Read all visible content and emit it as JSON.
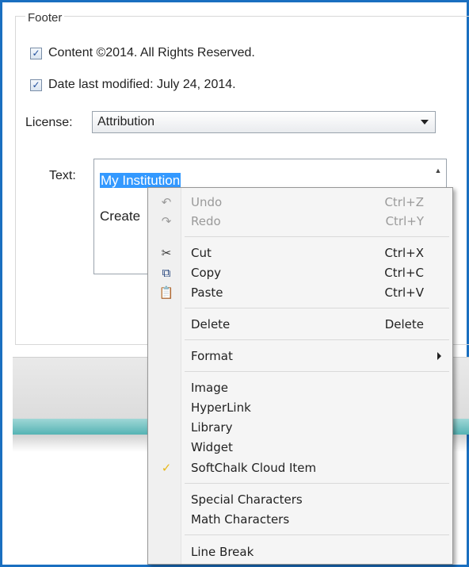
{
  "footer": {
    "legend": "Footer",
    "content_checkbox": {
      "checked": true,
      "label": "Content ©2014. All Rights Reserved."
    },
    "date_checkbox": {
      "checked": true,
      "label": "Date last modified: July 24, 2014."
    },
    "license": {
      "label": "License:",
      "value": "Attribution"
    },
    "text": {
      "label": "Text:",
      "line1_selected": "My Institution",
      "line2": "Create"
    }
  },
  "context_menu": {
    "undo": {
      "label": "Undo",
      "shortcut": "Ctrl+Z",
      "enabled": false,
      "icon": "undo-icon"
    },
    "redo": {
      "label": "Redo",
      "shortcut": "Ctrl+Y",
      "enabled": false,
      "icon": "redo-icon"
    },
    "cut": {
      "label": "Cut",
      "shortcut": "Ctrl+X",
      "icon": "scissors-icon"
    },
    "copy": {
      "label": "Copy",
      "shortcut": "Ctrl+C",
      "icon": "copy-icon"
    },
    "paste": {
      "label": "Paste",
      "shortcut": "Ctrl+V",
      "icon": "paste-icon"
    },
    "delete": {
      "label": "Delete",
      "shortcut": "Delete"
    },
    "format": {
      "label": "Format",
      "has_submenu": true
    },
    "image": {
      "label": "Image"
    },
    "hyperlink": {
      "label": "HyperLink"
    },
    "library": {
      "label": "Library"
    },
    "widget": {
      "label": "Widget"
    },
    "softchalk_cloud": {
      "label": "SoftChalk Cloud Item",
      "icon": "checkmark-icon"
    },
    "special_chars": {
      "label": "Special Characters"
    },
    "math_chars": {
      "label": "Math Characters"
    },
    "line_break": {
      "label": "Line Break"
    }
  },
  "colors": {
    "frame": "#1a6fc0",
    "selection": "#3399ff",
    "teal_band": "#55b3b4"
  }
}
